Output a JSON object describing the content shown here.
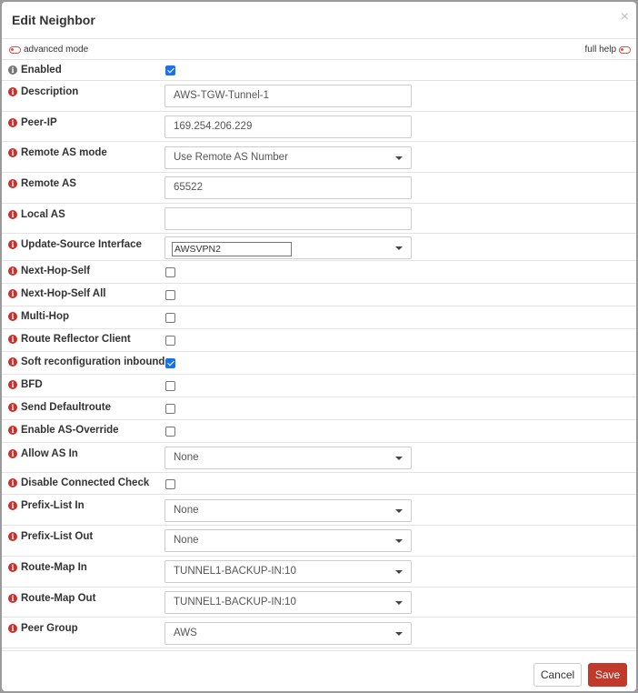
{
  "dialog": {
    "title": "Edit Neighbor",
    "close_glyph": "×"
  },
  "modes": {
    "advanced_label": "advanced mode",
    "help_label": "full help"
  },
  "fields": [
    {
      "label": "Enabled",
      "type": "checkbox",
      "checked": true,
      "info_color": "gray"
    },
    {
      "label": "Description",
      "type": "text",
      "value": "AWS-TGW-Tunnel-1"
    },
    {
      "label": "Peer-IP",
      "type": "text",
      "value": "169.254.206.229"
    },
    {
      "label": "Remote AS mode",
      "type": "select",
      "value": "Use Remote AS Number"
    },
    {
      "label": "Remote AS",
      "type": "text",
      "value": "65522"
    },
    {
      "label": "Local AS",
      "type": "text",
      "value": ""
    },
    {
      "label": "Update-Source Interface",
      "type": "select-input",
      "value": "AWSVPN2"
    },
    {
      "label": "Next-Hop-Self",
      "type": "checkbox",
      "checked": false
    },
    {
      "label": "Next-Hop-Self All",
      "type": "checkbox",
      "checked": false
    },
    {
      "label": "Multi-Hop",
      "type": "checkbox",
      "checked": false
    },
    {
      "label": "Route Reflector Client",
      "type": "checkbox",
      "checked": false
    },
    {
      "label": "Soft reconfiguration inbound",
      "type": "checkbox",
      "checked": true
    },
    {
      "label": "BFD",
      "type": "checkbox",
      "checked": false
    },
    {
      "label": "Send Defaultroute",
      "type": "checkbox",
      "checked": false
    },
    {
      "label": "Enable AS-Override",
      "type": "checkbox",
      "checked": false
    },
    {
      "label": "Allow AS In",
      "type": "select",
      "value": "None"
    },
    {
      "label": "Disable Connected Check",
      "type": "checkbox",
      "checked": false
    },
    {
      "label": "Prefix-List In",
      "type": "select",
      "value": "None"
    },
    {
      "label": "Prefix-List Out",
      "type": "select",
      "value": "None"
    },
    {
      "label": "Route-Map In",
      "type": "select",
      "value": "TUNNEL1-BACKUP-IN:10"
    },
    {
      "label": "Route-Map Out",
      "type": "select",
      "value": "TUNNEL1-BACKUP-IN:10"
    },
    {
      "label": "Peer Group",
      "type": "select",
      "value": "AWS"
    }
  ],
  "footer": {
    "cancel_label": "Cancel",
    "save_label": "Save"
  },
  "colors": {
    "accent": "#c0392b",
    "checkbox": "#1a73e8",
    "info_icon": "#c9302c"
  }
}
